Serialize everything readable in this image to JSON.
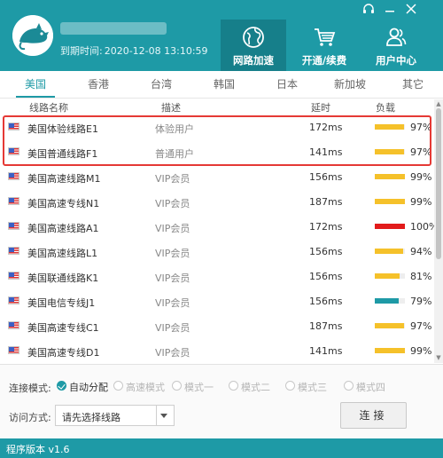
{
  "header": {
    "expire_label": "到期时间:",
    "expire_date": "2020-12-08 13:10:59",
    "nav": [
      {
        "label": "网路加速",
        "icon": "globe-icon",
        "active": true
      },
      {
        "label": "开通/续费",
        "icon": "shopping-cart-icon",
        "active": false
      },
      {
        "label": "用户中心",
        "icon": "users-icon",
        "active": false
      }
    ],
    "controls": [
      "headset-icon",
      "minimize-icon",
      "close-icon"
    ]
  },
  "tabs": [
    "美国",
    "香港",
    "台湾",
    "韩国",
    "日本",
    "新加坡",
    "其它"
  ],
  "active_tab": 0,
  "columns": {
    "name": "线路名称",
    "desc": "描述",
    "latency": "延时",
    "load": "负载"
  },
  "rows": [
    {
      "name": "美国体验线路E1",
      "desc": "体验用户",
      "latency": "172ms",
      "load": "97%",
      "load_value": 0.97,
      "bar_color": "#f5c12a"
    },
    {
      "name": "美国普通线路F1",
      "desc": "普通用户",
      "latency": "141ms",
      "load": "97%",
      "load_value": 0.97,
      "bar_color": "#f5c12a"
    },
    {
      "name": "美国高速线路M1",
      "desc": "VIP会员",
      "latency": "156ms",
      "load": "99%",
      "load_value": 0.99,
      "bar_color": "#f5c12a"
    },
    {
      "name": "美国高速专线N1",
      "desc": "VIP会员",
      "latency": "187ms",
      "load": "99%",
      "load_value": 0.99,
      "bar_color": "#f5c12a"
    },
    {
      "name": "美国高速线路A1",
      "desc": "VIP会员",
      "latency": "172ms",
      "load": "100%",
      "load_value": 1.0,
      "bar_color": "#e21b1b"
    },
    {
      "name": "美国高速线路L1",
      "desc": "VIP会员",
      "latency": "156ms",
      "load": "94%",
      "load_value": 0.94,
      "bar_color": "#f5c12a"
    },
    {
      "name": "美国联通线路K1",
      "desc": "VIP会员",
      "latency": "156ms",
      "load": "81%",
      "load_value": 0.81,
      "bar_color": "#f5c12a"
    },
    {
      "name": "美国电信专线J1",
      "desc": "VIP会员",
      "latency": "156ms",
      "load": "79%",
      "load_value": 0.79,
      "bar_color": "#1e9aa6"
    },
    {
      "name": "美国高速专线C1",
      "desc": "VIP会员",
      "latency": "187ms",
      "load": "97%",
      "load_value": 0.97,
      "bar_color": "#f5c12a"
    },
    {
      "name": "美国高速专线D1",
      "desc": "VIP会员",
      "latency": "141ms",
      "load": "99%",
      "load_value": 0.99,
      "bar_color": "#f5c12a"
    }
  ],
  "connection": {
    "mode_label": "连接模式:",
    "modes": [
      {
        "label": "自动分配",
        "checked": true
      },
      {
        "label": "高速模式",
        "checked": false
      },
      {
        "label": "模式一",
        "checked": false
      },
      {
        "label": "模式二",
        "checked": false
      },
      {
        "label": "模式三",
        "checked": false
      },
      {
        "label": "模式四",
        "checked": false
      }
    ],
    "access_label": "访问方式:",
    "select_value": "请先选择线路",
    "connect_button": "连接"
  },
  "footer": {
    "version": "程序版本 v1.6"
  },
  "colors": {
    "primary": "#1e9aa6",
    "highlight_border": "#e53935",
    "load_high": "#f5c12a",
    "load_full": "#e21b1b"
  }
}
